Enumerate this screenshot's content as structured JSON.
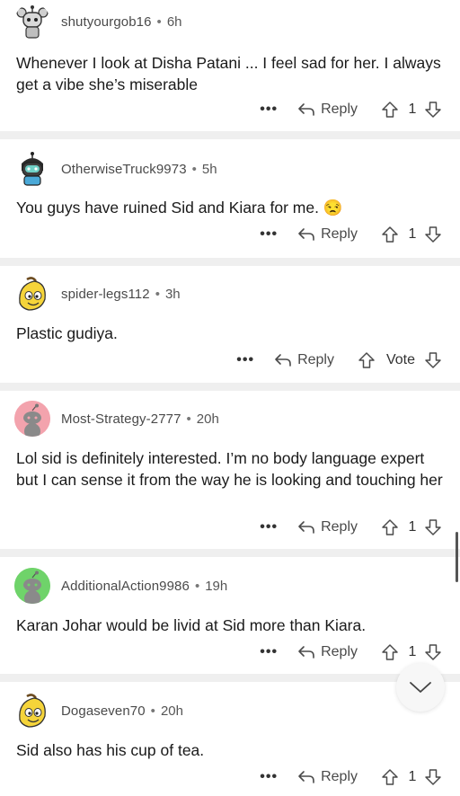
{
  "comments": [
    {
      "username": "shutyourgob16",
      "age": "6h",
      "text": "Whenever I look at Disha Patani ... I feel sad for her. I always get a vibe she’s miserable",
      "reply_label": "Reply",
      "vote": "1",
      "avatar": "avatar-robot-gray"
    },
    {
      "username": "OtherwiseTruck9973",
      "age": "5h",
      "text": "You guys have ruined Sid and Kiara for me. 😒",
      "reply_label": "Reply",
      "vote": "1",
      "avatar": "avatar-robot-teal"
    },
    {
      "username": "spider-legs112",
      "age": "3h",
      "text": "Plastic gudiya.",
      "reply_label": "Reply",
      "vote": "Vote",
      "avatar": "avatar-banana"
    },
    {
      "username": "Most-Strategy-2777",
      "age": "20h",
      "text": "Lol sid is definitely interested. I’m no body language expert but I can sense it from the way he is looking and touching her",
      "reply_label": "Reply",
      "vote": "1",
      "avatar": "avatar-snoo-pink"
    },
    {
      "username": "AdditionalAction9986",
      "age": "19h",
      "text": "Karan Johar would be livid at Sid more than Kiara.",
      "reply_label": "Reply",
      "vote": "1",
      "avatar": "avatar-snoo-green"
    },
    {
      "username": "Dogaseven70",
      "age": "20h",
      "text": "Sid also has his cup of tea.",
      "reply_label": "Reply",
      "vote": "1",
      "avatar": "avatar-banana"
    }
  ],
  "more_glyph": "•••",
  "dot": "•",
  "colors": {
    "separator": "#efefef",
    "text": "#1a1a1a",
    "meta": "#555555",
    "snoo_pink_bg": "#f3a3ad",
    "snoo_green_bg": "#6fd36a"
  }
}
